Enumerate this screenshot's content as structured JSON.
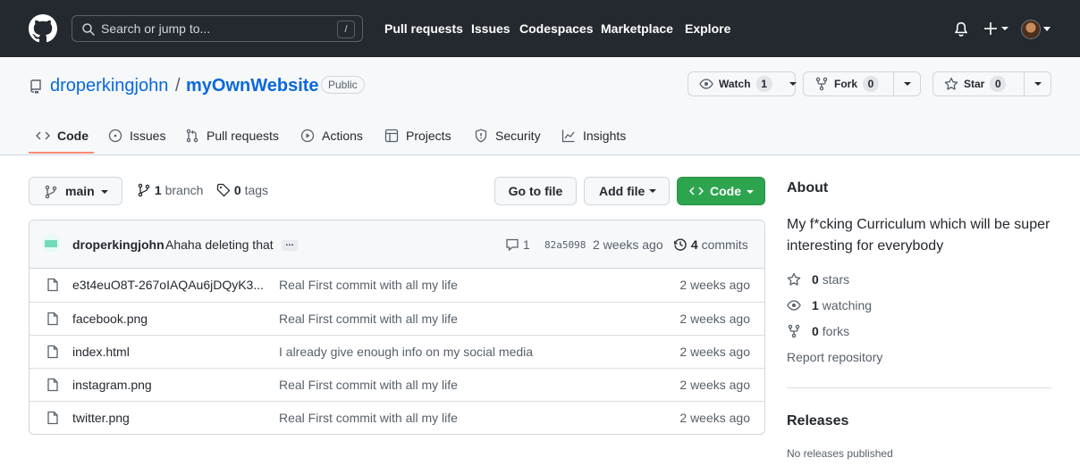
{
  "header": {
    "search_placeholder": "Search or jump to...",
    "search_shortcut": "/",
    "nav": [
      "Pull requests",
      "Issues",
      "Codespaces",
      "Marketplace",
      "Explore"
    ]
  },
  "repo": {
    "owner": "droperkingjohn",
    "separator": "/",
    "name": "myOwnWebsite",
    "visibility": "Public",
    "watch": {
      "label": "Watch",
      "count": "1"
    },
    "fork": {
      "label": "Fork",
      "count": "0"
    },
    "star": {
      "label": "Star",
      "count": "0"
    }
  },
  "tabs": [
    "Code",
    "Issues",
    "Pull requests",
    "Actions",
    "Projects",
    "Security",
    "Insights"
  ],
  "branch": {
    "name": "main",
    "branch_count": "1",
    "branch_label": "branch",
    "tag_count": "0",
    "tag_label": "tags"
  },
  "actions": {
    "go_to_file": "Go to file",
    "add_file": "Add file",
    "code": "Code"
  },
  "commit": {
    "author": "droperkingjohn",
    "message": "Ahaha deleting that",
    "ellipsis": "…",
    "comments": "1",
    "sha": "82a5098",
    "time": "2 weeks ago",
    "commit_count": "4",
    "commit_label": "commits"
  },
  "files": [
    {
      "name": "e3t4euO8T-267oIAQAu6jDQyK3...",
      "message": "Real First commit with all my life",
      "time": "2 weeks ago"
    },
    {
      "name": "facebook.png",
      "message": "Real First commit with all my life",
      "time": "2 weeks ago"
    },
    {
      "name": "index.html",
      "message": "I already give enough info on my social media",
      "time": "2 weeks ago"
    },
    {
      "name": "instagram.png",
      "message": "Real First commit with all my life",
      "time": "2 weeks ago"
    },
    {
      "name": "twitter.png",
      "message": "Real First commit with all my life",
      "time": "2 weeks ago"
    }
  ],
  "sidebar": {
    "about_title": "About",
    "description": "My f*cking Curriculum which will be super interesting for everybody",
    "stars": {
      "count": "0",
      "label": "stars"
    },
    "watching": {
      "count": "1",
      "label": "watching"
    },
    "forks": {
      "count": "0",
      "label": "forks"
    },
    "report": "Report repository",
    "releases_title": "Releases",
    "no_releases": "No releases published"
  },
  "colors": {
    "header_bg": "#24292f",
    "link": "#0969da",
    "code_button": "#2da44e",
    "active_tab_underline": "#fd8c73"
  }
}
